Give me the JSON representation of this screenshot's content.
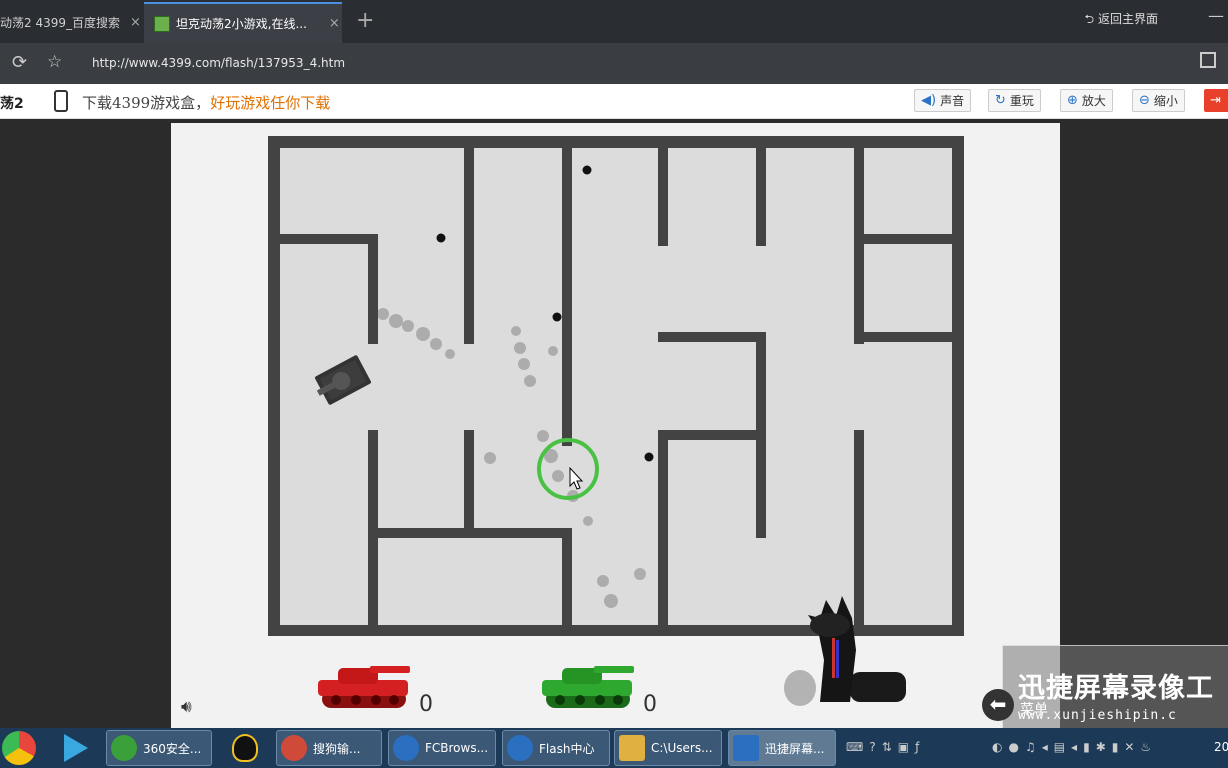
{
  "tabs": [
    {
      "title": "动荡2 4399_百度搜索",
      "close": "×"
    },
    {
      "title": "坦克动荡2小游戏,在线...",
      "close": "×"
    }
  ],
  "new_tab": "+",
  "return_home": "返回主界面",
  "minimize": "—",
  "url": "http://www.4399.com/flash/137953_4.htm",
  "game_title_fragment": "荡2",
  "promo": {
    "part1": "下载4399游戏盒，",
    "part2": "好玩游戏任你下载"
  },
  "toolbar": [
    {
      "label": "声音",
      "icon": "speaker-icon"
    },
    {
      "label": "重玩",
      "icon": "replay-icon"
    },
    {
      "label": "放大",
      "icon": "zoom-in-icon"
    },
    {
      "label": "缩小",
      "icon": "zoom-out-icon"
    }
  ],
  "scores": {
    "red": "0",
    "green": "0"
  },
  "watermark": {
    "title": "迅捷屏幕录像工",
    "url": "www.xunjieshipin.c"
  },
  "menu_label": "菜单",
  "taskbar": [
    {
      "label": "360安全...",
      "color": "#3aa03a"
    },
    {
      "label": "",
      "color": "#222222"
    },
    {
      "label": "搜狗输...",
      "color": "#d04a3a"
    },
    {
      "label": "FCBrows...",
      "color": "#2a6fc0"
    },
    {
      "label": "Flash中心",
      "color": "#2a6fc0"
    },
    {
      "label": "C:\\Users...",
      "color": "#e0b040"
    },
    {
      "label": "迅捷屏幕...",
      "color": "#2a6fc0"
    }
  ],
  "clock": "20",
  "colors": {
    "wall": "#434343",
    "floor": "#dcdcdc",
    "red_tank": "#d42020",
    "green_tank": "#2fa82f",
    "cursor_ring": "#49c244"
  }
}
